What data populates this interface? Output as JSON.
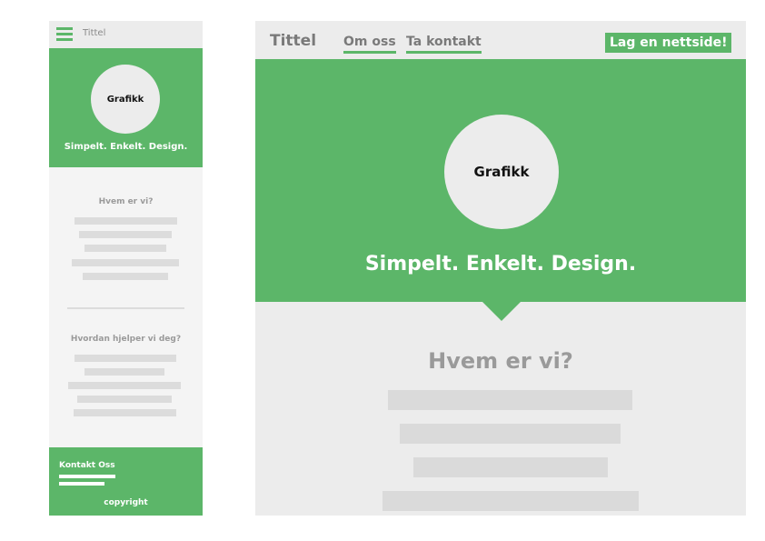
{
  "mobile": {
    "title": "Tittel",
    "graphic_label": "Grafikk",
    "tagline": "Simpelt. Enkelt. Design.",
    "section1_heading": "Hvem er vi?",
    "section2_heading": "Hvordan hjelper vi deg?",
    "footer_contact": "Kontakt Oss",
    "footer_copyright": "copyright"
  },
  "desktop": {
    "title": "Tittel",
    "nav": [
      "Om oss",
      "Ta kontakt"
    ],
    "cta": "Lag en nettside!",
    "graphic_label": "Grafikk",
    "tagline": "Simpelt. Enkelt. Design.",
    "section_heading": "Hvem er vi?"
  },
  "colors": {
    "accent_green": "#5cb669",
    "panel_gray": "#ececec",
    "placeholder_gray": "#dadada",
    "heading_gray": "#9a9a9a"
  },
  "icons": {
    "menu": "hamburger-icon"
  }
}
